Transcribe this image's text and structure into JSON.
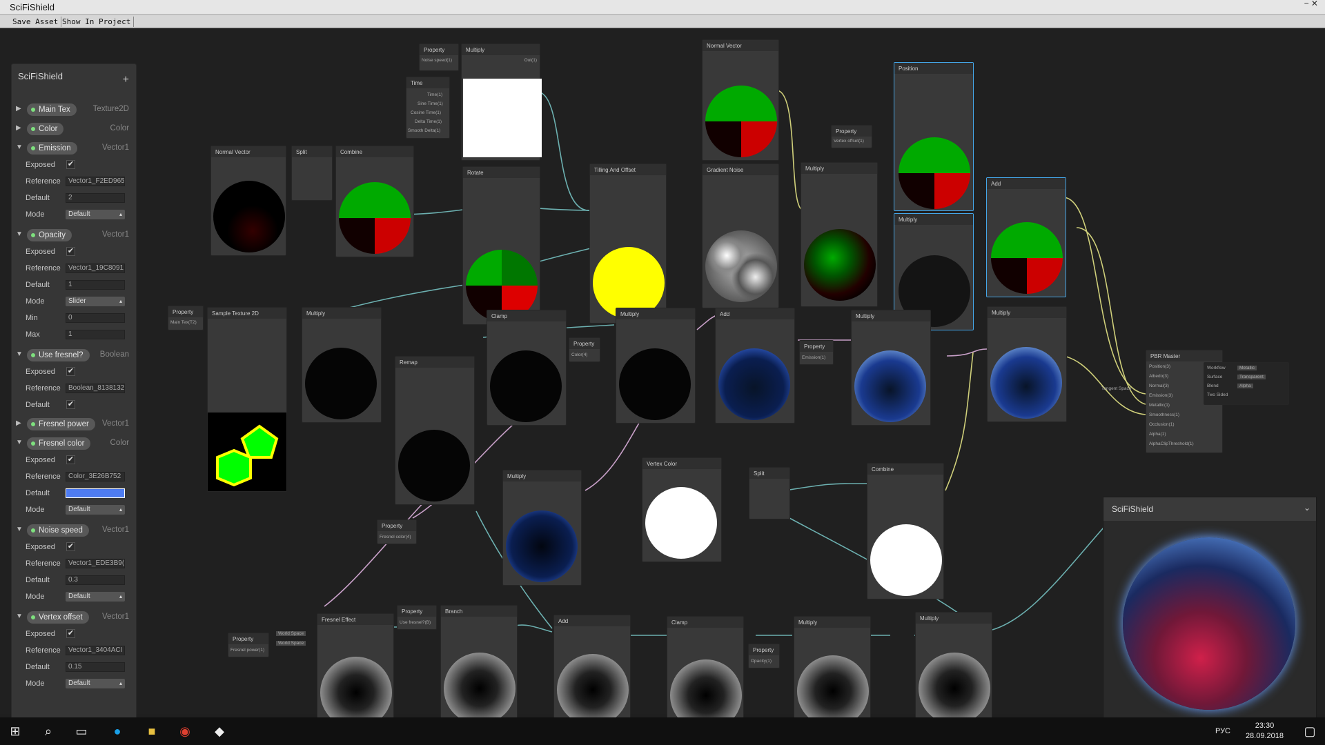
{
  "window": {
    "title": "SciFiShield",
    "controls": "− ✕"
  },
  "toolbar": {
    "save": "Save Asset",
    "show": "Show In Project"
  },
  "blackboard": {
    "title": "SciFiShield",
    "add": "+"
  },
  "props": [
    {
      "name": "Main Tex",
      "type": "Texture2D"
    },
    {
      "name": "Color",
      "type": "Color"
    },
    {
      "name": "Emission",
      "type": "Vector1",
      "exposed": "✔",
      "reference": "Vector1_F2ED965",
      "default": "2",
      "mode": "Default"
    },
    {
      "name": "Opacity",
      "type": "Vector1",
      "exposed": "✔",
      "reference": "Vector1_19C8091",
      "default": "1",
      "mode": "Slider",
      "min": "0",
      "max": "1"
    },
    {
      "name": "Use fresnel?",
      "type": "Boolean",
      "exposed": "✔",
      "reference": "Boolean_8138132",
      "default": "✔"
    },
    {
      "name": "Fresnel power",
      "type": "Vector1"
    },
    {
      "name": "Fresnel color",
      "type": "Color",
      "exposed": "✔",
      "reference": "Color_3E26B752",
      "mode": "Default"
    },
    {
      "name": "Noise speed",
      "type": "Vector1",
      "exposed": "✔",
      "reference": "Vector1_EDE3B9(",
      "default": "0.3",
      "mode": "Default"
    },
    {
      "name": "Vertex offset",
      "type": "Vector1",
      "exposed": "✔",
      "reference": "Vector1_3404ACI",
      "default": "0.15",
      "mode": "Default"
    }
  ],
  "labels": {
    "exposed": "Exposed",
    "reference": "Reference",
    "default": "Default",
    "mode": "Mode",
    "min": "Min",
    "max": "Max"
  },
  "nodes": {
    "n1": "Property",
    "n2": "Multiply",
    "n3": "Time",
    "n4": "Normal Vector",
    "n5": "Split",
    "n6": "Combine",
    "n7": "Rotate",
    "n8": "Tilling And Offset",
    "n9": "Normal Vector",
    "n10": "Gradient Noise",
    "n11": "Property",
    "n12": "Multiply",
    "n13": "Position",
    "n14": "Multiply",
    "n15": "Add",
    "n16": "Property",
    "n17": "Sample Texture 2D",
    "n18": "Multiply",
    "n19": "Remap",
    "n20": "Clamp",
    "n21": "Property",
    "n22": "Multiply",
    "n23": "Add",
    "n24": "Property",
    "n25": "Multiply",
    "n26": "Multiply",
    "n27": "PBR Master",
    "n28": "Multiply",
    "n29": "Property",
    "n30": "Vertex Color",
    "n31": "Split",
    "n32": "Combine",
    "n33": "Property",
    "n34": "Fresnel Effect",
    "n35": "Property",
    "n36": "Branch",
    "n37": "Add",
    "n38": "Clamp",
    "n39": "Property",
    "n40": "Multiply",
    "n41": "Multiply"
  },
  "ports": {
    "noise_speed": "Noise speed(1)",
    "time": "Time(1)",
    "sine": "Sine Time(1)",
    "cos": "Cosine Time(1)",
    "delta": "Delta Time(1)",
    "smooth": "Smooth Delta(1)",
    "main_tex": "Main Tex(T2)",
    "color": "Color(4)",
    "emission": "Emission(1)",
    "fresnel_color": "Fresnel color(4)",
    "fresnel_power": "Fresnel power(1)",
    "vertex_offset": "Vertex offset(1)",
    "opacity": "Opacity(1)",
    "use_fresnel": "Use fresnel?(B)",
    "out": "Out(1)",
    "master_ports": [
      "Position(3)",
      "Albedo(3)",
      "Normal(3)",
      "Emission(3)",
      "Metallic(1)",
      "Smoothness(1)",
      "Occlusion(1)",
      "Alpha(1)",
      "AlphaClipThreshold(1)"
    ],
    "master_settings": [
      [
        "Workflow",
        "Metallic"
      ],
      [
        "Surface",
        "Transparent"
      ],
      [
        "Blend",
        "Alpha"
      ],
      [
        "Two Sided",
        ""
      ]
    ],
    "tangent": "Tangent Space",
    "world": "World Space"
  },
  "preview": {
    "title": "SciFiShield",
    "chev": "⌄"
  },
  "taskbar": {
    "lang": "РУС",
    "time": "23:30",
    "date": "28.09.2018"
  }
}
